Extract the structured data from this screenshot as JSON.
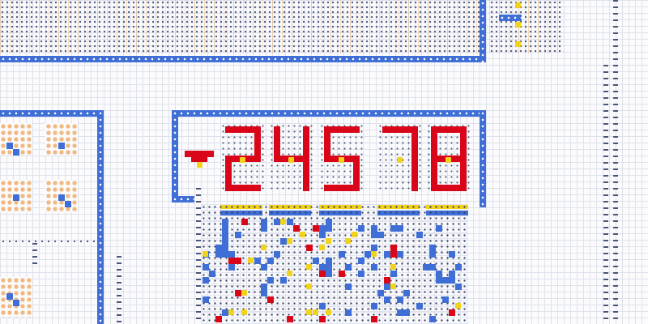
{
  "display": {
    "sign": "-",
    "digits": [
      "2",
      "4",
      "5",
      "7",
      "8"
    ]
  },
  "colors": {
    "wire": "#3f6fd6",
    "segment": "#d9061a",
    "highlight": "#f2d21a",
    "tile_dot": "#f0b982",
    "grid": "#dfe2ea"
  }
}
